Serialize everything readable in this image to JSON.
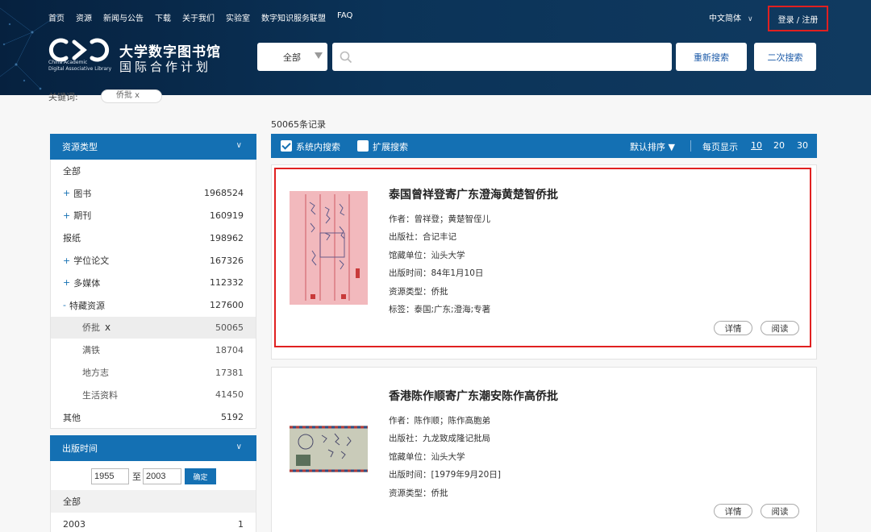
{
  "nav": {
    "items": [
      "首页",
      "资源",
      "新闻与公告",
      "下载",
      "关于我们",
      "实验室",
      "数字知识服务联盟",
      "FAQ"
    ],
    "language": "中文简体",
    "login": "登录 / 注册"
  },
  "brand": {
    "en_line1": "China Academic",
    "en_line2": "Digital Associative Library",
    "cn_line1": "大学数字图书馆",
    "cn_line2": "国际合作计划"
  },
  "search": {
    "scope": "全部",
    "placeholder": "",
    "research_button": "重新搜索",
    "second_button": "二次搜索"
  },
  "keyword": {
    "label": "关键词:",
    "chip": "侨批    x"
  },
  "results": {
    "count": "50065条记录"
  },
  "toolbar": {
    "in_system": "系统内搜索",
    "extend": "扩展搜索",
    "sort": "默认排序 ▼",
    "per_page_label": "每页显示",
    "per_page_options": [
      "10",
      "20",
      "30"
    ]
  },
  "sidebar": {
    "resource_type": {
      "title": "资源类型",
      "items": [
        {
          "label": "全部",
          "count": ""
        },
        {
          "label": "图书",
          "count": "1968524"
        },
        {
          "label": "期刊",
          "count": "160919"
        },
        {
          "label": "报纸",
          "count": "198962"
        },
        {
          "label": "学位论文",
          "count": "167326"
        },
        {
          "label": "多媒体",
          "count": "112332"
        },
        {
          "label": "特藏资源",
          "count": "127600"
        },
        {
          "label": "侨批",
          "count": "50065"
        },
        {
          "label": "满铁",
          "count": "18704"
        },
        {
          "label": "地方志",
          "count": "17381"
        },
        {
          "label": "生活资料",
          "count": "41450"
        },
        {
          "label": "其他",
          "count": "5192"
        }
      ]
    },
    "pub_time": {
      "title": "出版时间",
      "from": "1955",
      "to_label": "至",
      "to": "2003",
      "confirm": "确定",
      "items": [
        {
          "label": "全部",
          "count": ""
        },
        {
          "label": "2003",
          "count": "1"
        }
      ]
    }
  },
  "cards": [
    {
      "title": "泰国曾祥登寄广东澄海黄楚智侨批",
      "author": "作者：曾祥登；黄楚智侄儿",
      "publisher": "出版社：合记丰记",
      "holder": "馆藏单位：汕头大学",
      "date": "出版时间：84年1月10日",
      "type": "资源类型：侨批",
      "tags": "标签：泰国;广东;澄海;专著",
      "detail": "详情",
      "read": "阅读"
    },
    {
      "title": "香港陈作顺寄广东潮安陈作高侨批",
      "author": "作者：陈作顺；陈作高胞弟",
      "publisher": "出版社：九龙致成隆记批局",
      "holder": "馆藏单位：汕头大学",
      "date": "出版时间：[1979年9月20日]",
      "type": "资源类型：侨批",
      "detail": "详情",
      "read": "阅读"
    }
  ],
  "colors": {
    "header_bg": "#0b3358",
    "accent": "#1470b3",
    "highlight": "#e02020"
  }
}
